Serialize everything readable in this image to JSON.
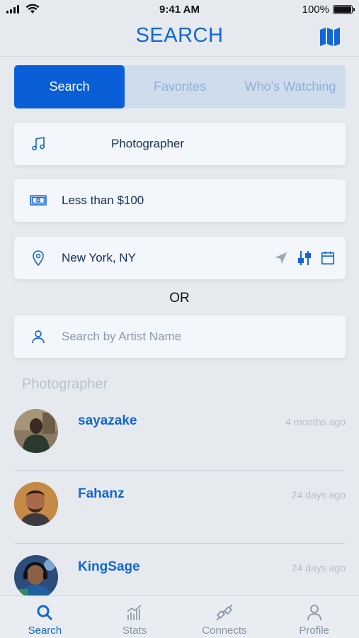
{
  "status_bar": {
    "time": "9:41 AM",
    "battery": "100%"
  },
  "header": {
    "title": "SEARCH",
    "map_icon": "map-icon"
  },
  "tabs": [
    {
      "label": "Search",
      "active": true
    },
    {
      "label": "Favorites",
      "active": false
    },
    {
      "label": "Who's Watching",
      "active": false
    }
  ],
  "filters": {
    "category": {
      "icon": "music-note-icon",
      "value": "Photographer"
    },
    "budget": {
      "icon": "money-icon",
      "value": "Less than $100"
    },
    "location": {
      "icon": "location-pin-icon",
      "value": "New York, NY"
    },
    "artist": {
      "icon": "person-icon",
      "placeholder": "Search by Artist Name"
    }
  },
  "or_label": "OR",
  "section_label": "Photographer",
  "results": [
    {
      "name": "sayazake",
      "when": "4 months ago"
    },
    {
      "name": "Fahanz",
      "when": "24 days ago"
    },
    {
      "name": "KingSage",
      "when": "24 days ago"
    }
  ],
  "tab_bar": [
    {
      "label": "Search",
      "icon": "search-icon",
      "active": true
    },
    {
      "label": "Stats",
      "icon": "stats-icon",
      "active": false
    },
    {
      "label": "Connects",
      "icon": "connects-icon",
      "active": false
    },
    {
      "label": "Profile",
      "icon": "profile-icon",
      "active": false
    }
  ],
  "colors": {
    "accent": "#1366d6",
    "tab_active": "#0a5fd9",
    "background": "#e6eaef"
  }
}
